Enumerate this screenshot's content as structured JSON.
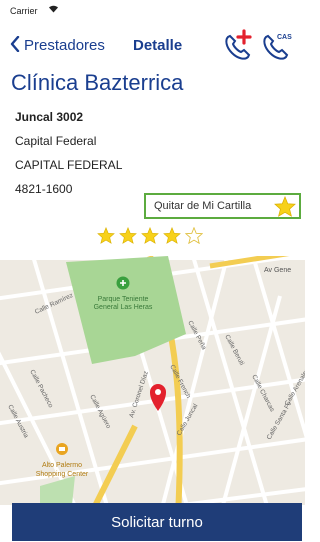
{
  "status_bar": {
    "carrier": "Carrier",
    "wifi_icon": "wifi-icon"
  },
  "nav": {
    "back_label": "Prestadores",
    "title": "Detalle",
    "call_add_icon": "phone-plus-icon",
    "call_cas_icon": "phone-cas-icon",
    "cas_text": "CAS"
  },
  "provider": {
    "name": "Clínica Bazterrica",
    "street": "Juncal 3002",
    "city": "Capital Federal",
    "state": "CAPITAL FEDERAL",
    "phone": "4821-1600"
  },
  "cartilla": {
    "label": "Quitar de Mi Cartilla",
    "star_color": "#f7d11a"
  },
  "rating": {
    "value": 4,
    "max": 5,
    "star_color": "#f7d11a"
  },
  "map": {
    "park_label_1": "Parque Teniente",
    "park_label_2": "General Las Heras",
    "street_labels": {
      "av_gen": "Av Gene",
      "av_coronel_diaz": "Av. Coronel Díaz",
      "calle_pena": "Calle Peña",
      "calle_french": "Calle French",
      "calle_juncal": "Calle Juncal",
      "calle_beruti": "Calle Beruti",
      "calle_santa_fe": "Calle Santa Fe",
      "calle_arenales": "Calle Arenales",
      "calle_charcas": "Calle Charcas",
      "calle_ramirez": "Calle Ramírez",
      "calle_pacheco": "Calle Pacheco",
      "calle_austria": "Calle Austria",
      "calle_agüero": "Calle Agüero"
    },
    "mall_label_1": "Alto Palermo",
    "mall_label_2": "Shopping Center"
  },
  "cta": {
    "label": "Solicitar turno"
  },
  "colors": {
    "brand_blue": "#1a3e8f",
    "cta_bg": "#1f3d78",
    "cartilla_border": "#5cab3f",
    "pin": "#e3212d"
  }
}
